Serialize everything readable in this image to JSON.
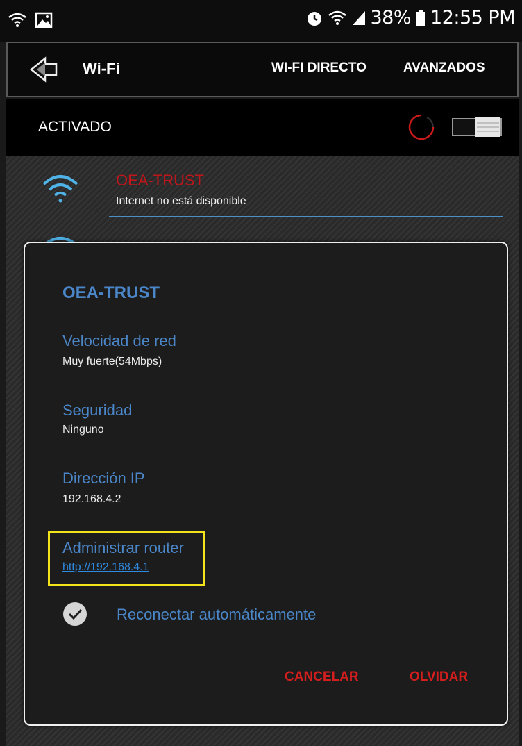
{
  "status_bar": {
    "left_icons": [
      "wifi-icon",
      "image-icon"
    ],
    "right_icons": [
      "alarm-icon",
      "wifi-icon",
      "signal-icon",
      "battery-icon"
    ],
    "battery": "38%",
    "time": "12:55 PM"
  },
  "header": {
    "title": "Wi-Fi",
    "tabs": [
      {
        "label": "WI-FI DIRECTO"
      },
      {
        "label": "AVANZADOS"
      }
    ]
  },
  "switch_row": {
    "label": "ACTIVADO",
    "state": "on"
  },
  "networks": [
    {
      "name": "OEA-TRUST",
      "status": "Internet no está disponible"
    }
  ],
  "dialog": {
    "title": "OEA-TRUST",
    "fields": [
      {
        "label": "Velocidad de red",
        "value": "Muy fuerte(54Mbps)"
      },
      {
        "label": "Seguridad",
        "value": "Ninguno"
      },
      {
        "label": "Dirección IP",
        "value": "192.168.4.2"
      }
    ],
    "router": {
      "label": "Administrar router",
      "link": "http://192.168.4.1"
    },
    "auto_reconnect": {
      "label": "Reconectar automáticamente",
      "checked": true
    },
    "buttons": {
      "cancel": "CANCELAR",
      "forget": "OLVIDAR"
    }
  },
  "colors": {
    "accent_blue": "#4a86c8",
    "link_blue": "#2f8ae0",
    "action_red": "#d41e1e",
    "network_red": "#c0161b",
    "highlight_yellow": "#f2e31b"
  }
}
